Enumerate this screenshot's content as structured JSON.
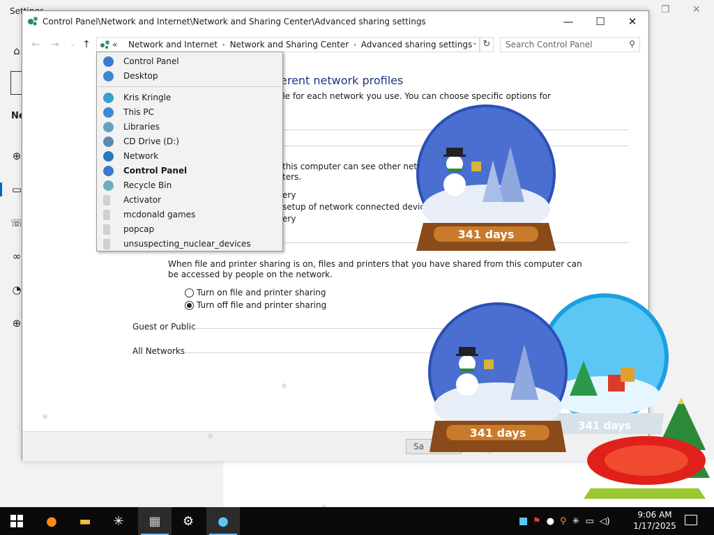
{
  "settings_window": {
    "title": "Settings",
    "nav_heading": "Ne",
    "restore_icon": "restore-icon",
    "close_icon": "close-icon"
  },
  "explorer": {
    "title": "Control Panel\\Network and Internet\\Network and Sharing Center\\Advanced sharing settings",
    "buttons": {
      "minimize": "—",
      "maximize": "☐",
      "close": "✕"
    },
    "address": {
      "chevron": "«",
      "crumbs": [
        "Network and Internet",
        "Network and Sharing Center",
        "Advanced sharing settings"
      ],
      "separator": "›"
    },
    "search": {
      "placeholder": "Search Control Panel"
    },
    "content": {
      "heading": "erent network profiles",
      "intro": "ile for each network you use. You can choose specific options for",
      "network_discovery_1": "this computer can see other network",
      "network_discovery_2": "ters.",
      "nd_opt1_tail": "ery",
      "nd_opt2_tail": "setup of network connected devices.",
      "nd_opt3_tail": "ery",
      "file_sharing_desc_1": "When file and printer sharing is on, files and printers that you have shared from this computer can",
      "file_sharing_desc_2": "be accessed by people on the network.",
      "radio_on": "Turn on file and printer sharing",
      "radio_off": "Turn off file and printer sharing",
      "section_guest": "Guest or Public",
      "section_all": "All Networks",
      "save_label": "Sa"
    }
  },
  "dropdown": {
    "items": [
      {
        "label": "Control Panel",
        "icon": "control-panel-icon",
        "bold": false
      },
      {
        "label": "Desktop",
        "icon": "desktop-icon",
        "bold": false
      },
      {
        "label": "Kris Kringle",
        "icon": "user-folder-icon",
        "bold": false
      },
      {
        "label": "This PC",
        "icon": "this-pc-icon",
        "bold": false
      },
      {
        "label": "Libraries",
        "icon": "libraries-icon",
        "bold": false
      },
      {
        "label": "CD Drive (D:)",
        "icon": "cd-drive-icon",
        "bold": false
      },
      {
        "label": "Network",
        "icon": "network-icon",
        "bold": false
      },
      {
        "label": "Control Panel",
        "icon": "control-panel-icon",
        "bold": true
      },
      {
        "label": "Recycle Bin",
        "icon": "recycle-bin-icon",
        "bold": false
      },
      {
        "label": "Activator",
        "icon": "folder-icon",
        "bold": false
      },
      {
        "label": "mcdonald games",
        "icon": "folder-icon",
        "bold": false
      },
      {
        "label": "popcap",
        "icon": "folder-icon",
        "bold": false
      },
      {
        "label": "unsuspecting_nuclear_devices",
        "icon": "folder-icon",
        "bold": false
      }
    ]
  },
  "globes": {
    "days_label": "341 days"
  },
  "taskbar": {
    "time": "9:06 AM",
    "date": "1/17/2025"
  }
}
